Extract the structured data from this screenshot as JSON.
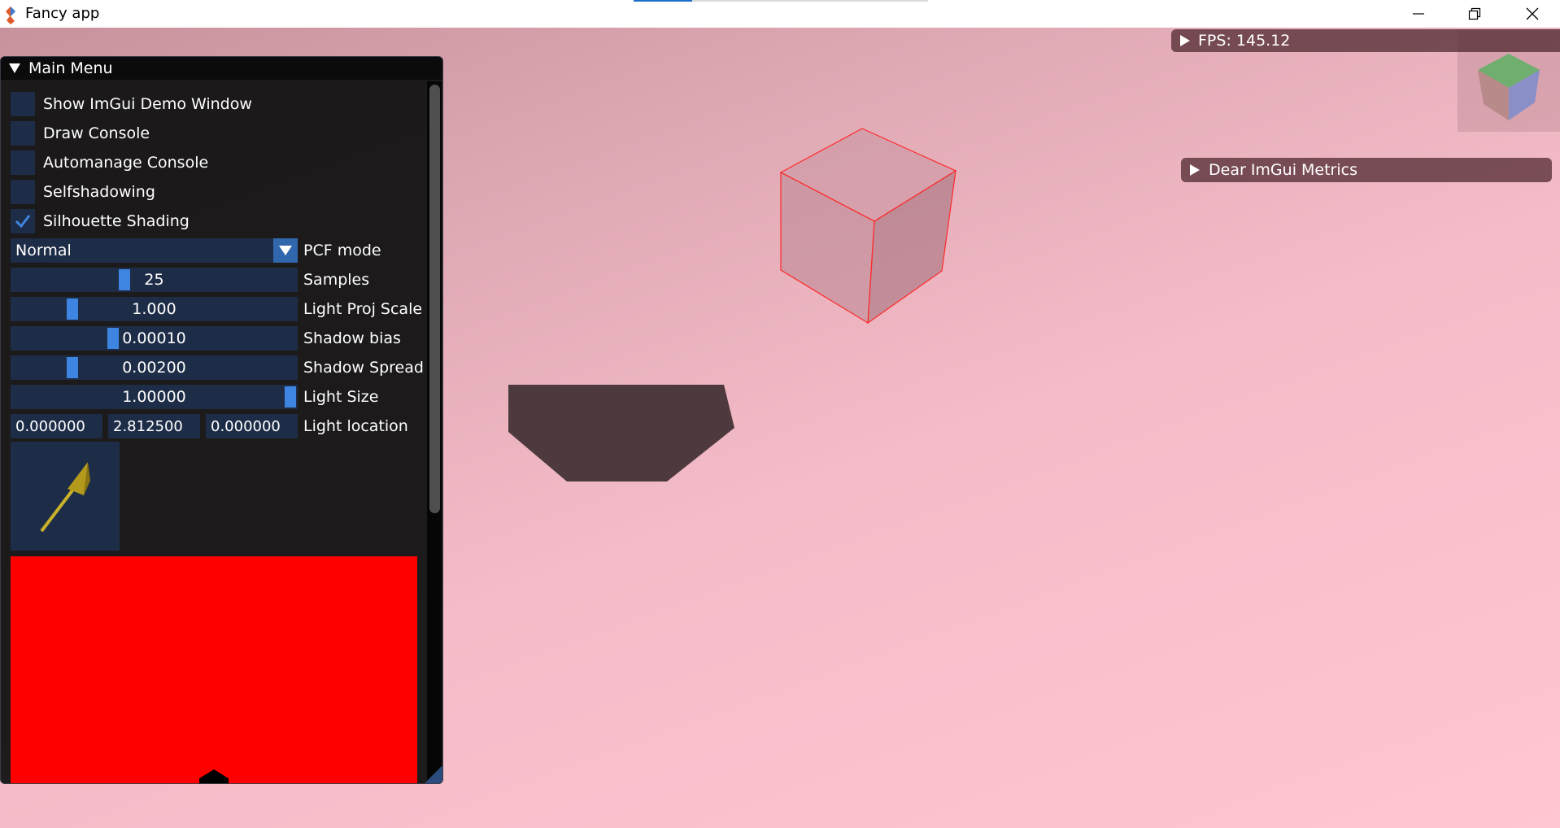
{
  "app": {
    "title": "Fancy app"
  },
  "main_menu": {
    "title": "Main Menu",
    "checkboxes": [
      {
        "label": "Show ImGui Demo Window",
        "checked": false
      },
      {
        "label": "Draw Console",
        "checked": false
      },
      {
        "label": "Automanage Console",
        "checked": false
      },
      {
        "label": "Selfshadowing",
        "checked": false
      },
      {
        "label": "Silhouette Shading",
        "checked": true
      }
    ],
    "pcf": {
      "value": "Normal",
      "label": "PCF mode"
    },
    "samples": {
      "value": "25",
      "label": "Samples",
      "fraction": 0.39
    },
    "light_proj_scale": {
      "value": "1.000",
      "label": "Light Proj Scale",
      "fraction": 0.2
    },
    "shadow_bias": {
      "value": "0.00010",
      "label": "Shadow bias",
      "fraction": 0.35
    },
    "shadow_spread": {
      "value": "0.00200",
      "label": "Shadow Spread",
      "fraction": 0.2
    },
    "light_size": {
      "value": "1.00000",
      "label": "Light Size",
      "fraction": 1.0
    },
    "light_location": {
      "x": "0.000000",
      "y": "2.812500",
      "z": "0.000000",
      "label": "Light location"
    }
  },
  "overlays": {
    "fps_label": "FPS: 145.12",
    "metrics_label": "Dear ImGui Metrics"
  },
  "colors": {
    "accent": "#3d85e0",
    "frame_bg": "#1e2d47",
    "window_bg": "#141414",
    "shadow_map": "#ff0000",
    "cube_edge": "#ff0000"
  }
}
